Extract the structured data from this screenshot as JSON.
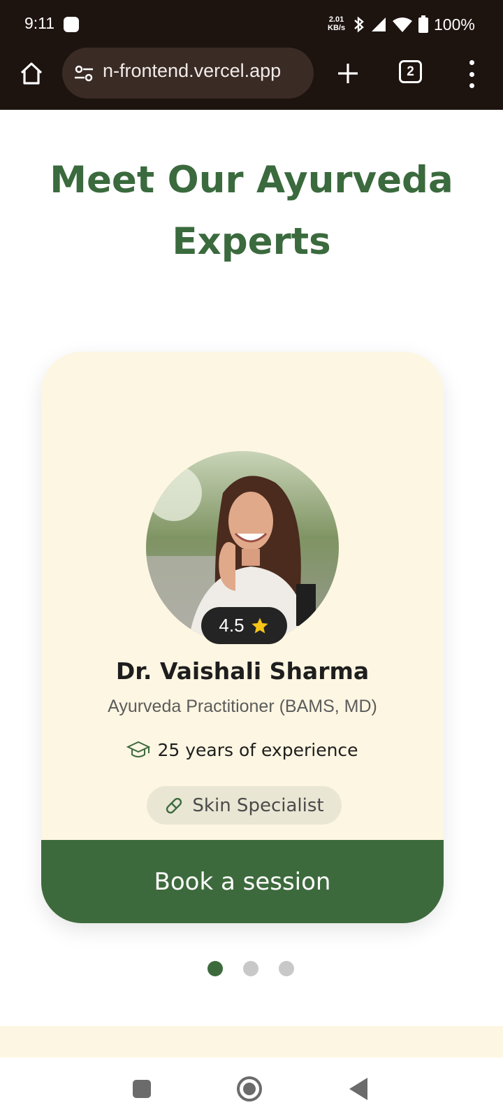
{
  "status_bar": {
    "time": "9:11",
    "net_speed_value": "2.01",
    "net_speed_unit": "KB/s",
    "battery": "100%",
    "icons": [
      "notification-dot-icon",
      "bluetooth-icon",
      "cell-signal-icon",
      "wifi-icon",
      "battery-icon"
    ]
  },
  "browser": {
    "url": "n-frontend.vercel.app",
    "tab_count": "2",
    "icons": [
      "home-icon",
      "site-settings-icon",
      "new-tab-icon",
      "tab-switcher-icon",
      "more-menu-icon"
    ]
  },
  "page": {
    "title": "Meet Our Ayurveda Experts"
  },
  "expert_card": {
    "rating": "4.5",
    "name": "Dr. Vaishali Sharma",
    "role": "Ayurveda Practitioner (BAMS, MD)",
    "experience": "25 years of experience",
    "specialty": "Skin Specialist",
    "cta_label": "Book a session"
  },
  "carousel": {
    "total_slides": 3,
    "active_index": 0
  },
  "colors": {
    "brand_green": "#3d6a3d",
    "title_green": "#3a6a3d",
    "card_bg": "#fdf6e2",
    "star": "#f6c518",
    "chrome_bg": "#1d130f"
  }
}
